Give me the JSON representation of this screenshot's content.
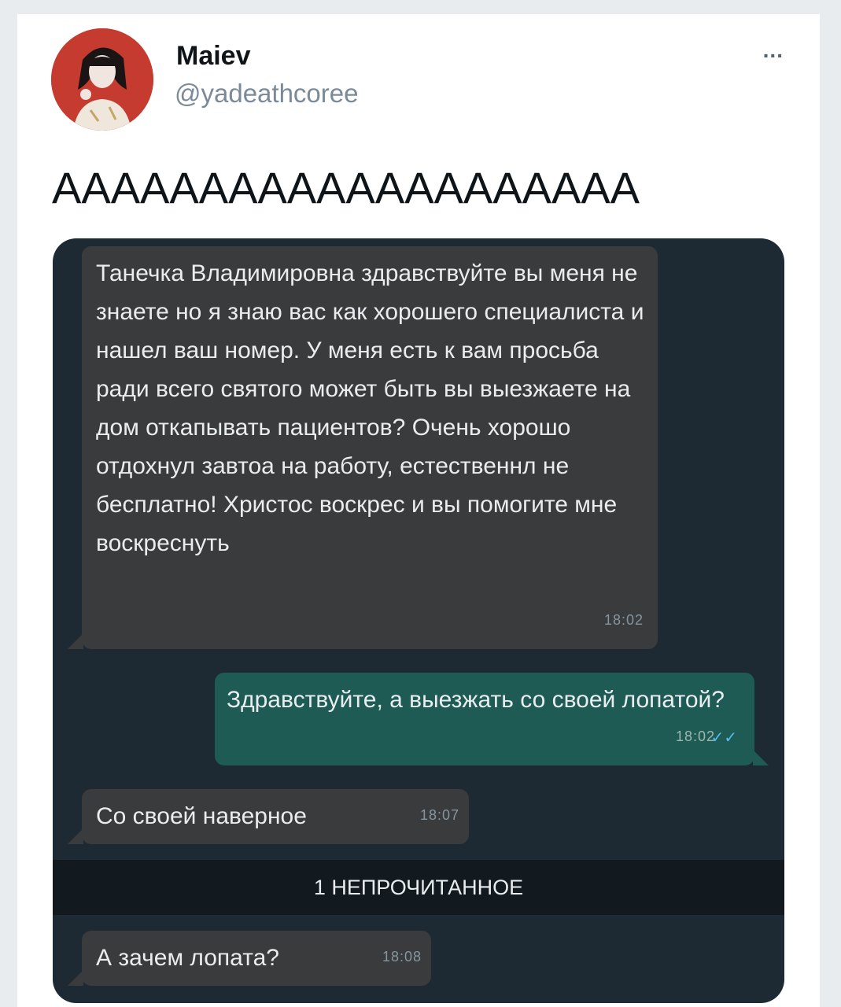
{
  "tweet": {
    "author_name": "Maiev",
    "author_handle": "@yadeathcoree",
    "more_label": "...",
    "text": "АААААААААААААААААААА"
  },
  "chat": {
    "messages": [
      {
        "direction": "incoming",
        "text": "Танечка Владимировна здравствуйте вы меня не знаете но я знаю вас как хорошего специалиста и нашел ваш номер. У меня есть к вам просьба ради всего святого может быть вы выезжаете на дом откапывать пациентов? Очень хорошо отдохнул завтоа на работу, естественнл не бесплатно! Христос воскрес и вы помогите мне воскреснуть",
        "time": "18:02"
      },
      {
        "direction": "outgoing",
        "text": "Здравствуйте, а выезжать со своей лопатой?",
        "time": "18:02",
        "read_icon": "double-check-icon"
      },
      {
        "direction": "incoming",
        "text": "Со своей наверное",
        "time": "18:07"
      },
      {
        "direction": "incoming",
        "text": "А зачем лопата?",
        "time": "18:08"
      }
    ],
    "unread_divider": "1 НЕПРОЧИТАННОЕ"
  },
  "colors": {
    "chat_background": "#1e2a33",
    "incoming_bubble": "#3a3b3d",
    "outgoing_bubble": "#1e5b54",
    "read_checks": "#53bdeb"
  }
}
